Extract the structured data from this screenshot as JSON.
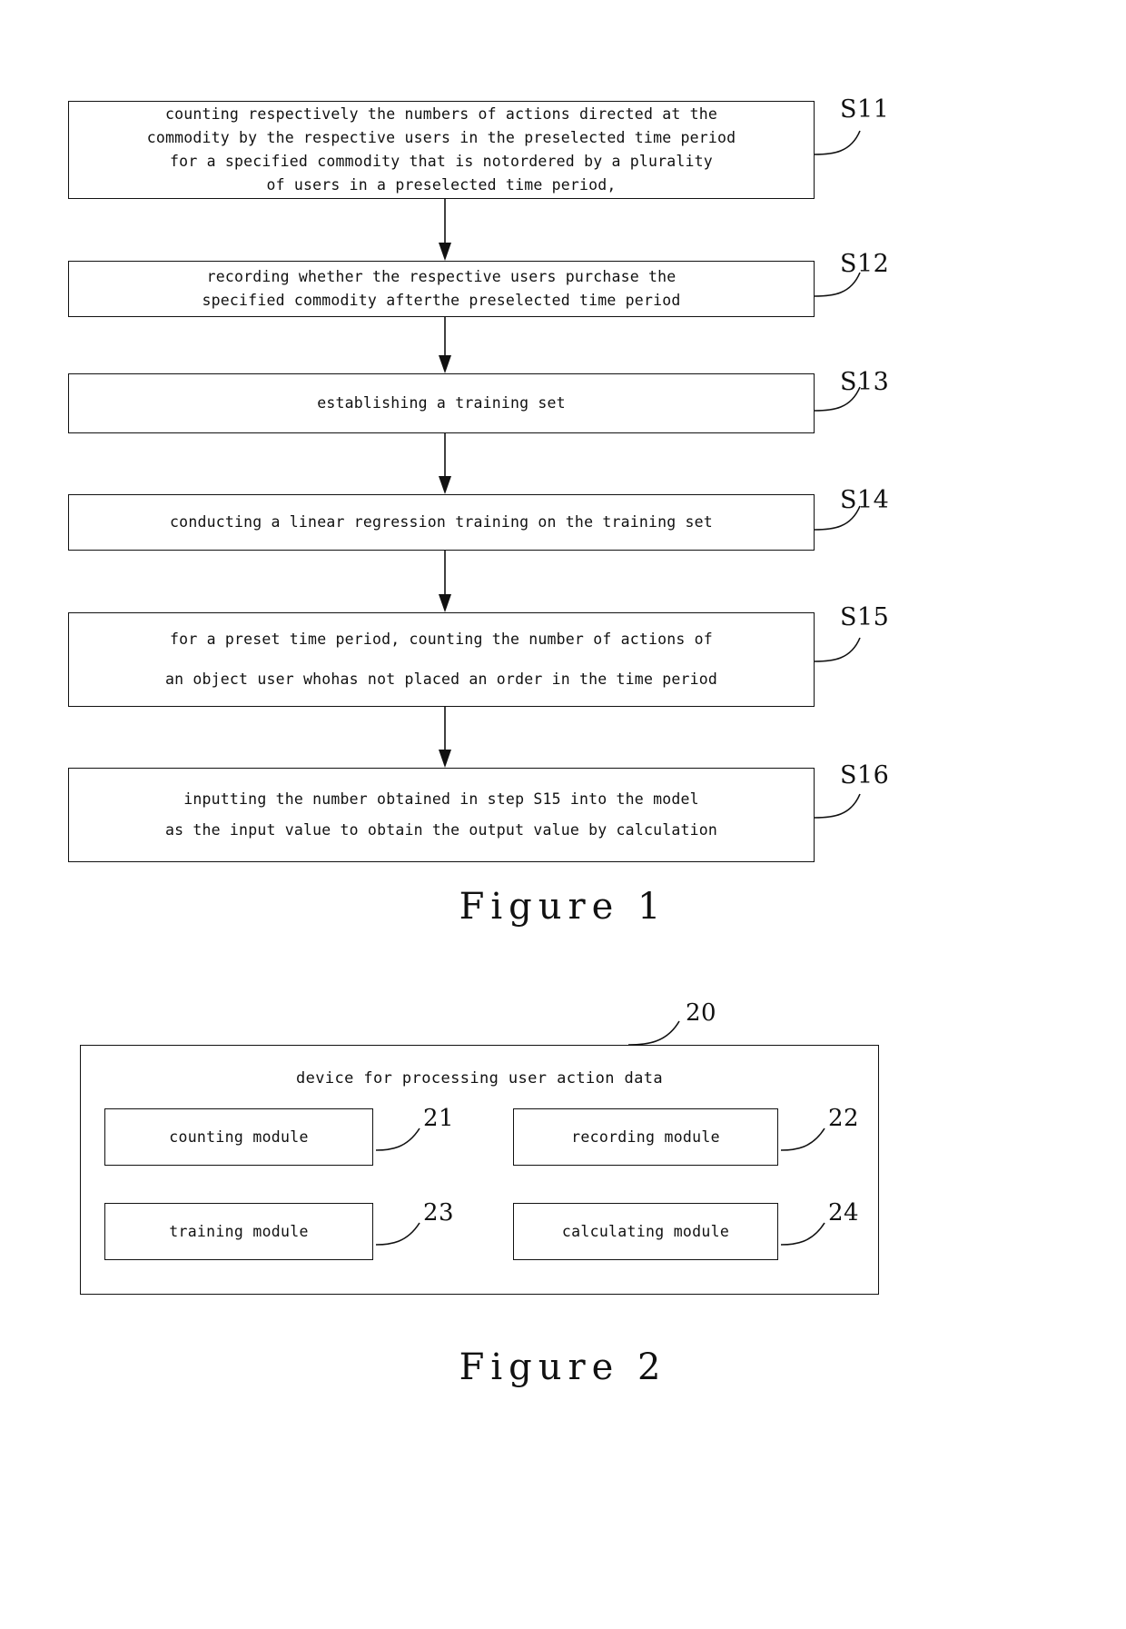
{
  "figure1": {
    "caption": "Figure 1",
    "steps": [
      {
        "ref": "S11",
        "lines": [
          "counting respectively the numbers of actions directed at the",
          "commodity by the respective users in the preselected time period",
          "for a specified commodity that is notordered by a plurality",
          "of users in a preselected time period,"
        ]
      },
      {
        "ref": "S12",
        "lines": [
          "recording whether the respective users purchase the",
          "specified commodity afterthe preselected time period"
        ]
      },
      {
        "ref": "S13",
        "lines": [
          "establishing a training set"
        ]
      },
      {
        "ref": "S14",
        "lines": [
          "conducting a linear regression training on the training set"
        ]
      },
      {
        "ref": "S15",
        "lines": [
          "for a preset time period, counting the number of actions of",
          "an object user whohas not placed an order in the time period"
        ]
      },
      {
        "ref": "S16",
        "lines": [
          "inputting the number obtained in step S15 into the model",
          "as the input value to obtain the output value by calculation"
        ]
      }
    ]
  },
  "figure2": {
    "caption": "Figure 2",
    "device_ref": "20",
    "device_title": "device for processing user action data",
    "modules": [
      {
        "ref": "21",
        "label": "counting module"
      },
      {
        "ref": "22",
        "label": "recording module"
      },
      {
        "ref": "23",
        "label": "training module"
      },
      {
        "ref": "24",
        "label": "calculating module"
      }
    ]
  },
  "colors": {
    "ink": "#111111",
    "background": "#ffffff"
  }
}
